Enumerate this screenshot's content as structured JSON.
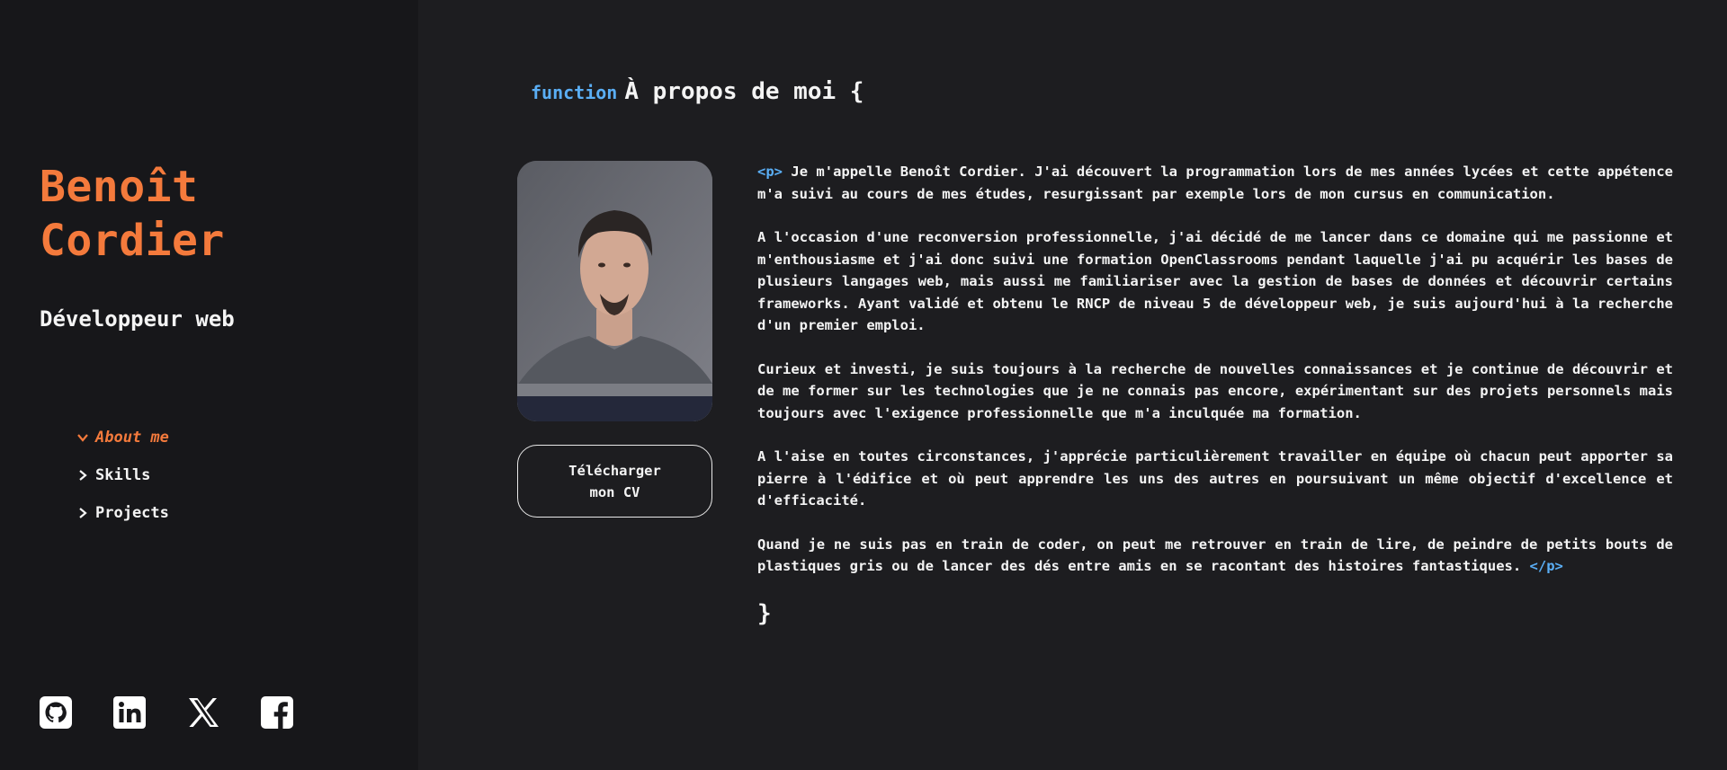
{
  "profile": {
    "first_name": "Benoît",
    "last_name": "Cordier",
    "job_title": "Développeur web"
  },
  "nav": {
    "items": [
      {
        "label": "About me",
        "active": true
      },
      {
        "label": "Skills",
        "active": false
      },
      {
        "label": "Projects",
        "active": false
      }
    ]
  },
  "socials": [
    "github-icon",
    "linkedin-icon",
    "x-icon",
    "facebook-icon"
  ],
  "section": {
    "keyword": "function",
    "title": "À propos de moi {",
    "close": "}"
  },
  "cv_button": {
    "label": "Télécharger mon CV"
  },
  "bio": {
    "open_tag": "<p>",
    "close_tag": "</p>",
    "paragraphs": [
      "Je m'appelle Benoît Cordier. J'ai découvert la programmation lors de mes années lycées et cette appétence m'a suivi au cours de mes études, resurgissant par exemple lors de mon cursus en communication.",
      "A l'occasion d'une reconversion professionnelle, j'ai décidé de me lancer dans ce domaine qui me passionne et m'enthousiasme et j'ai donc suivi une formation OpenClassrooms pendant laquelle j'ai pu acquérir les bases de plusieurs langages web, mais aussi me familiariser avec la gestion de bases de données et découvrir certains frameworks. Ayant validé et obtenu le RNCP de niveau 5 de développeur web, je suis aujourd'hui à la recherche d'un premier emploi.",
      "Curieux et investi, je suis toujours à la recherche de nouvelles connaissances et je continue de découvrir et de me former sur les technologies que je ne connais pas encore, expérimentant sur des projets personnels mais toujours avec l'exigence professionnelle que m'a inculquée ma formation.",
      "A l'aise en toutes circonstances, j'apprécie particulièrement travailler en équipe où chacun peut apporter sa pierre à l'édifice et où peut apprendre les uns des autres en poursuivant un même objectif d'excellence et d'efficacité.",
      "Quand je ne suis pas en train de coder, on peut me retrouver en train de lire, de peindre de petits bouts de plastiques gris ou de lancer des dés entre amis en se racontant des histoires fantastiques."
    ]
  },
  "colors": {
    "accent": "#f47a3c",
    "keyword": "#5aaef5",
    "sidebar_bg": "#17171a",
    "main_bg": "#1d1d20"
  }
}
